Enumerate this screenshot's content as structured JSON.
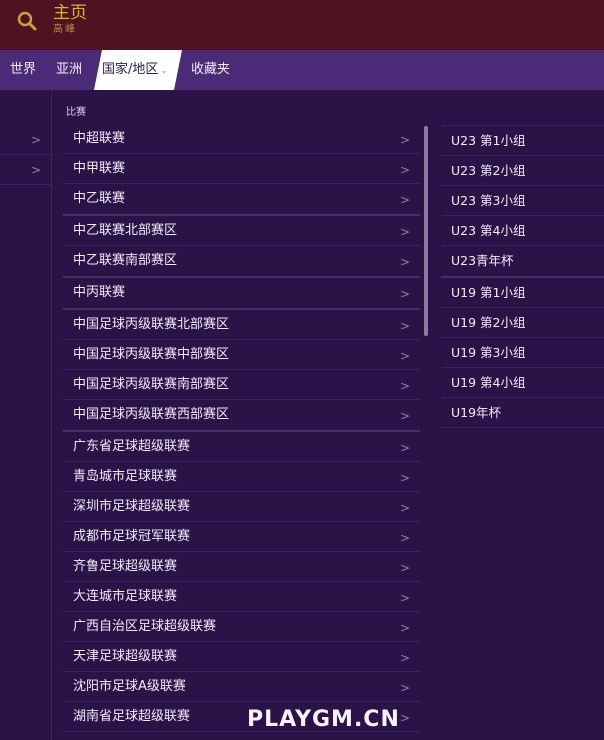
{
  "header": {
    "title": "主页",
    "subtitle": "高峰"
  },
  "tabs": [
    "世界",
    "亚洲",
    "国家/地区",
    "收藏夹"
  ],
  "section_label": "比赛",
  "competitions": [
    "中超联赛",
    "中甲联赛",
    "中乙联赛",
    "中乙联赛北部赛区",
    "中乙联赛南部赛区",
    "中丙联赛",
    "中国足球丙级联赛北部赛区",
    "中国足球丙级联赛中部赛区",
    "中国足球丙级联赛南部赛区",
    "中国足球丙级联赛西部赛区",
    "广东省足球超级联赛",
    "青岛城市足球联赛",
    "深圳市足球超级联赛",
    "成都市足球冠军联赛",
    "齐鲁足球超级联赛",
    "大连城市足球联赛",
    "广西自治区足球超级联赛",
    "天津足球超级联赛",
    "沈阳市足球A级联赛",
    "湖南省足球超级联赛"
  ],
  "sub_competitions": [
    "U23 第1小组",
    "U23 第2小组",
    "U23 第3小组",
    "U23 第4小组",
    "U23青年杯",
    "U19 第1小组",
    "U19 第2小组",
    "U19 第3小组",
    "U19 第4小组",
    "U19年杯"
  ],
  "arrow": ">",
  "watermark": "PLAYGM.CN"
}
